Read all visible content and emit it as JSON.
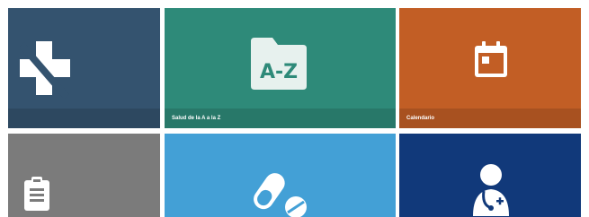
{
  "tiles": [
    {
      "id": "health-logo",
      "label": "",
      "color": "#34536f",
      "icon": "medical-cross-icon"
    },
    {
      "id": "salud-a-z",
      "label": "Salud de la A a la Z",
      "color": "#2e8a79",
      "icon": "folder-a-z-icon",
      "icon_text": "A-Z"
    },
    {
      "id": "calendario",
      "label": "Calendario",
      "color": "#c25e25",
      "icon": "calendar-icon"
    },
    {
      "id": "clipboard",
      "label": "",
      "color": "#7b7b7b",
      "icon": "clipboard-icon"
    },
    {
      "id": "medicamentos",
      "label": "",
      "color": "#43a0d6",
      "icon": "pills-icon"
    },
    {
      "id": "medicos",
      "label": "",
      "color": "#11397a",
      "icon": "doctor-icon"
    }
  ]
}
